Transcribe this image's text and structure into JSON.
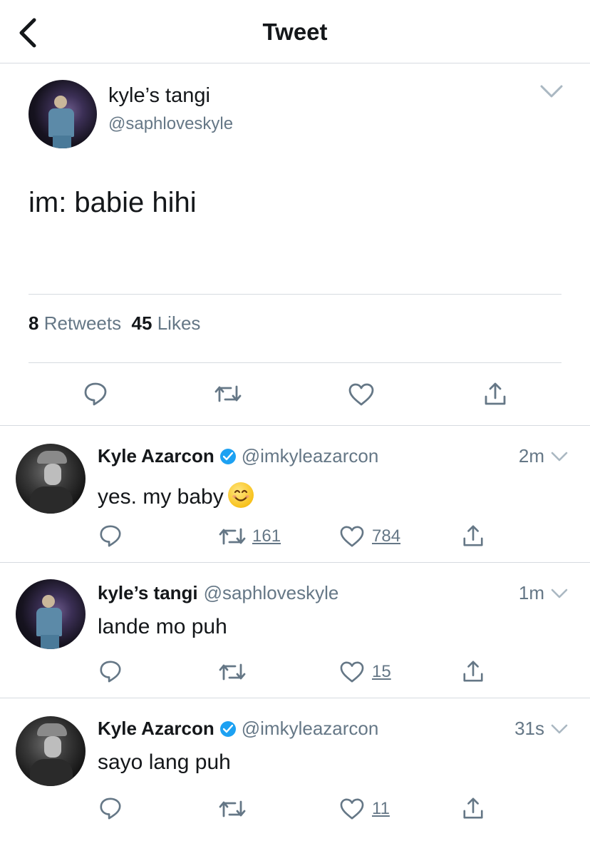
{
  "header": {
    "title": "Tweet",
    "back_icon": "chevron-left-icon"
  },
  "main_tweet": {
    "author_name": "kyle’s tangi",
    "author_handle": "@saphloveskyle",
    "text": "im: babie hihi",
    "retweets_count": "8",
    "retweets_label": "Retweets",
    "likes_count": "45",
    "likes_label": "Likes"
  },
  "replies": [
    {
      "name": "Kyle Azarcon",
      "verified": true,
      "handle": "@imkyleazarcon",
      "time": "2m",
      "text": "yes. my baby",
      "retweets": "161",
      "likes": "784"
    },
    {
      "name": "kyle’s tangi",
      "verified": false,
      "handle": "@saphloveskyle",
      "time": "1m",
      "text": "lande mo puh",
      "retweets": "",
      "likes": "15"
    },
    {
      "name": "Kyle Azarcon",
      "verified": true,
      "handle": "@imkyleazarcon",
      "time": "31s",
      "text": "sayo lang puh",
      "retweets": "",
      "likes": "11"
    }
  ],
  "colors": {
    "text": "#14171a",
    "secondary": "#657786",
    "divider": "#d6dbe0",
    "verified": "#1da1f2"
  }
}
